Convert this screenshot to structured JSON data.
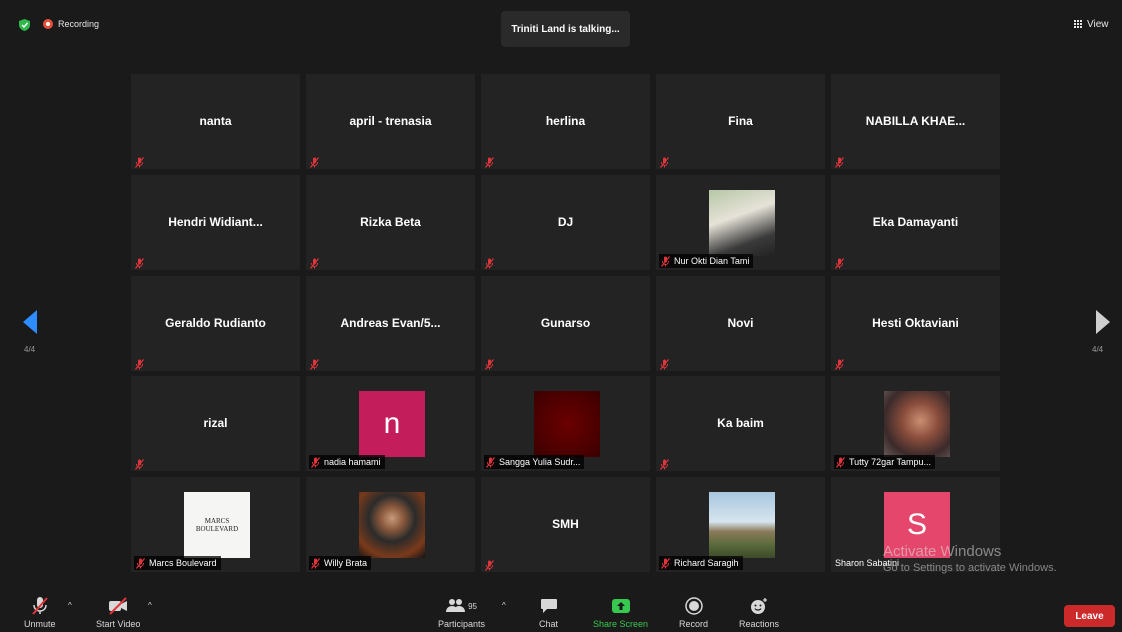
{
  "top": {
    "recording_label": "Recording",
    "talking_label": "Triniti Land is talking...",
    "view_label": "View"
  },
  "pager": {
    "left_label": "4/4",
    "right_label": "4/4"
  },
  "participants": [
    {
      "name": "nanta",
      "label_style": "center"
    },
    {
      "name": "april - trenasia",
      "label_style": "center"
    },
    {
      "name": "herlina",
      "label_style": "center"
    },
    {
      "name": "Fina",
      "label_style": "center"
    },
    {
      "name": "NABILLA KHAE...",
      "label_style": "center"
    },
    {
      "name": "Hendri  Widiant...",
      "label_style": "center"
    },
    {
      "name": "Rizka Beta",
      "label_style": "center"
    },
    {
      "name": "DJ",
      "label_style": "center"
    },
    {
      "name": "Nur Okti Dian Tami",
      "label_style": "tag",
      "photo": "woman-photo"
    },
    {
      "name": "Eka Damayanti",
      "label_style": "center"
    },
    {
      "name": "Geraldo Rudianto",
      "label_style": "center"
    },
    {
      "name": "Andreas  Evan/5...",
      "label_style": "center"
    },
    {
      "name": "Gunarso",
      "label_style": "center"
    },
    {
      "name": "Novi",
      "label_style": "center"
    },
    {
      "name": "Hesti Oktaviani",
      "label_style": "center"
    },
    {
      "name": "rizal",
      "label_style": "center"
    },
    {
      "name": "nadia hamami",
      "label_style": "tag",
      "avatar_letter": "n"
    },
    {
      "name": "Sangga Yulia Sudr...",
      "label_style": "tag",
      "photo": "red-photo"
    },
    {
      "name": "Ka baim",
      "label_style": "center"
    },
    {
      "name": "Tutty 72gar Tampu...",
      "label_style": "tag",
      "photo": "woman-photo-2"
    },
    {
      "name": "Marcs Boulevard",
      "label_style": "tag",
      "logo_line1": "MARCS",
      "logo_line2": "BOULEVARD"
    },
    {
      "name": "Willy Brata",
      "label_style": "tag",
      "photo": "man-photo"
    },
    {
      "name": "SMH",
      "label_style": "center"
    },
    {
      "name": "Richard Saragih",
      "label_style": "tag",
      "photo": "outdoor-photo"
    },
    {
      "name": "Sharon Sabatini",
      "label_style": "tag-plain",
      "avatar_letter": "S"
    }
  ],
  "watermark": {
    "line1": "Activate Windows",
    "line2": "Go to Settings to activate Windows."
  },
  "toolbar": {
    "unmute_label": "Unmute",
    "start_video_label": "Start Video",
    "participants_label": "Participants",
    "participants_count": "95",
    "chat_label": "Chat",
    "share_screen_label": "Share Screen",
    "record_label": "Record",
    "reactions_label": "Reactions",
    "leave_label": "Leave"
  },
  "colors": {
    "accent_blue": "#2d8cff",
    "share_green": "#37c84f",
    "leave_red": "#cc2a2a",
    "muted_red": "#e0353b",
    "tile_bg": "#232323"
  }
}
